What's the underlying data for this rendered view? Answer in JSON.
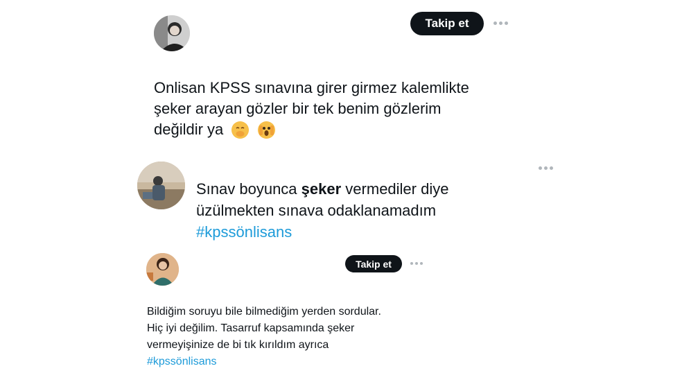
{
  "post1": {
    "follow_label": "Takip et",
    "line1": "Onlisan KPSS sınavına girer girmez kalemlikte",
    "line2": "şeker arayan gözler  bir tek benim gözlerim",
    "line3": "değildir ya",
    "emojis": [
      "face-with-hand-over-mouth-emoji",
      "face-screaming-in-fear-emoji"
    ]
  },
  "post2": {
    "line1_before": "Sınav boyunca ",
    "line1_bold": "şeker",
    "line1_after": " vermediler diye",
    "line2": "üzülmekten sınava odaklanamadım",
    "hashtag": "#kpssönlisans"
  },
  "post3": {
    "follow_label": "Takip et",
    "line1": "Bildiğim soruyu bile bilmediğim yerden sordular.",
    "line2": "Hiç iyi değilim. Tasarruf kapsamında şeker",
    "line3": "vermeyişinize de bi tık kırıldım ayrıca",
    "hashtag": "#kpssönlisans"
  },
  "colors": {
    "button_bg": "#0f1419",
    "hashtag": "#1d9bd9",
    "text": "#0f1419"
  }
}
